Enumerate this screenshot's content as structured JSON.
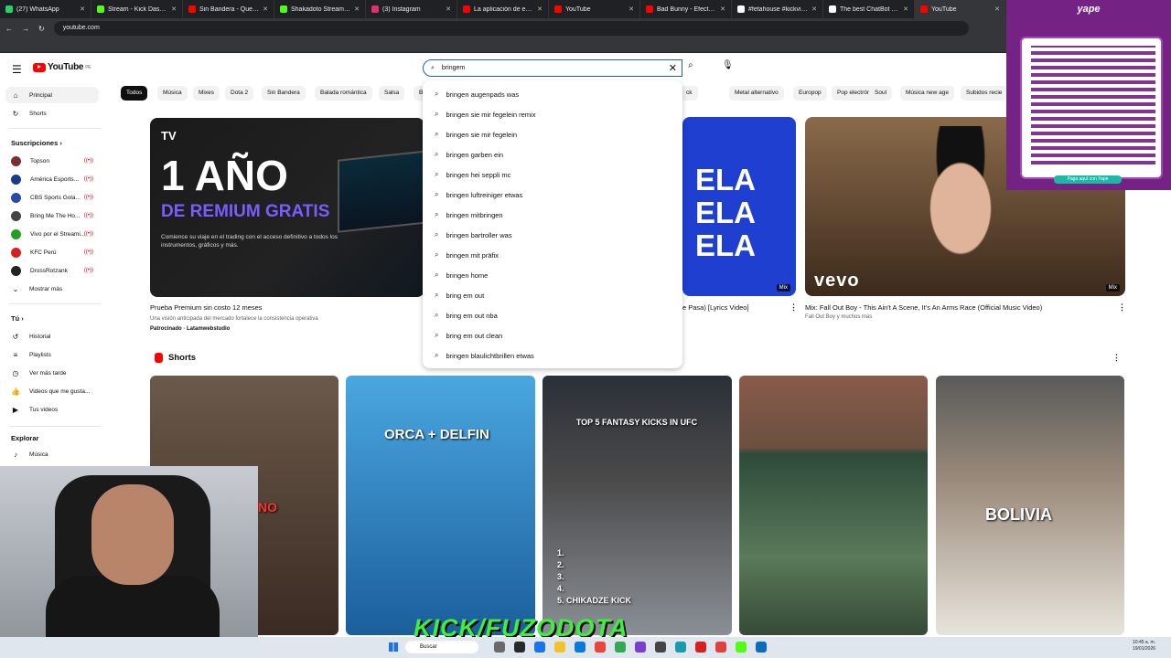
{
  "browser": {
    "tabs": [
      {
        "title": "(27) WhatsApp",
        "color": "#25d366"
      },
      {
        "title": "Stream - Kick Dashboard",
        "color": "#53fc18"
      },
      {
        "title": "Sin Bandera - Que Lloro (",
        "color": "#ff0000"
      },
      {
        "title": "Shakadoto Stream - Watch",
        "color": "#53fc18"
      },
      {
        "title": "(3) Instagram",
        "color": "#e1306c"
      },
      {
        "title": "La aplicación de escritorio",
        "color": "#ff0000"
      },
      {
        "title": "YouTube",
        "color": "#ff0000"
      },
      {
        "title": "Bad Bunny - Efecto (360°",
        "color": "#ff0000"
      },
      {
        "title": "#fetahouse #kickviralclip",
        "color": "#ffffff"
      },
      {
        "title": "The best ChatBot and Wid",
        "color": "#ffffff"
      },
      {
        "title": "YouTube",
        "color": "#ff0000"
      }
    ],
    "url": "youtube.com"
  },
  "yape": {
    "brand": "yape",
    "pay_label": "Paga aquí con Yape"
  },
  "youtube": {
    "logo_text": "YouTube",
    "logo_sup": "PE",
    "search_value": "bringem",
    "suggestions": [
      "bringen augenpads was",
      "bringen sie mir fegelein remix",
      "bringen sie mir fegelein",
      "bringen garben ein",
      "bringen hei seppli mc",
      "bringen luftreiniger etwas",
      "bringen mitbringen",
      "bringen bartroller was",
      "bringen mit präfix",
      "bringen home",
      "bring em out",
      "bring em out nba",
      "bring em out clean",
      "bringen blaulichtbrillen etwas"
    ],
    "sidebar": {
      "home": "Principal",
      "shorts": "Shorts",
      "subscriptions_header": "Suscripciones",
      "subscriptions": [
        {
          "name": "Topson",
          "color": "#7a3030"
        },
        {
          "name": "América Esports...",
          "color": "#1c3a8c"
        },
        {
          "name": "CBS Sports Golа...",
          "color": "#2a4aa8"
        },
        {
          "name": "Bring Me The Ho...",
          "color": "#444444"
        },
        {
          "name": "Vivo por el Streami...",
          "color": "#22a022"
        },
        {
          "name": "KFC Perú",
          "color": "#d62020"
        },
        {
          "name": "DrossRotzank",
          "color": "#222222"
        }
      ],
      "show_more": "Mostrar más",
      "you_header": "Tú",
      "you_items": [
        "Historial",
        "Playlists",
        "Ver más tarde",
        "Videos que me gusta...",
        "Tus videos"
      ],
      "explore_header": "Explorar",
      "explore_items": [
        "Música"
      ]
    },
    "chips": [
      "Todos",
      "Música",
      "Mixes",
      "Dota 2",
      "Sin Bandera",
      "Balada romántica",
      "Salsa",
      "B",
      "ck",
      "Metal alternativo",
      "Europop",
      "Pop electrónico",
      "Soul",
      "Música new age",
      "Subidos recie"
    ],
    "videos": [
      {
        "thumb_big": "1 AÑO",
        "thumb_sub": "DE REMIUM GRATIS",
        "thumb_desc": "Comience su viaje en el trading con el acceso definitivo a todos los instrumentos, gráficos y más.",
        "thumb_brand": "TV",
        "title": "Prueba Premium sin costo 12 meses",
        "meta": "Una visión anticipada del mercado fortalece la consistencia operativa",
        "meta2": "Patrocinado · Latamwebstudio"
      },
      {
        "thumb_lines": [
          "ELA",
          "ELA",
          "ELA"
        ],
        "title": "e Pasa) [Lyrics Video]",
        "badge": "Mix"
      },
      {
        "thumb_brand": "vevo",
        "title": "Mix: Fall Out Boy - This Ain't A Scene, It's An Arms Race (Official Music Video)",
        "meta": "Fall Out Boy y muchos más",
        "badge": "Mix"
      }
    ],
    "shorts_header": "Shorts",
    "shorts": [
      {
        "text": "NO"
      },
      {
        "text": "ORCA + DELFIN"
      },
      {
        "text": "TOP 5 FANTASY KICKS IN UFC",
        "list": "1.\n2.\n3.\n4.\n5. CHIKADZE KICK"
      },
      {
        "text": ""
      },
      {
        "text": "BOLIVIA"
      }
    ]
  },
  "overlay": {
    "kick_text": "KICK/FUZODOTA"
  },
  "taskbar": {
    "search_placeholder": "Buscar",
    "time": "10:45 a. m.",
    "date": "19/01/2026"
  }
}
